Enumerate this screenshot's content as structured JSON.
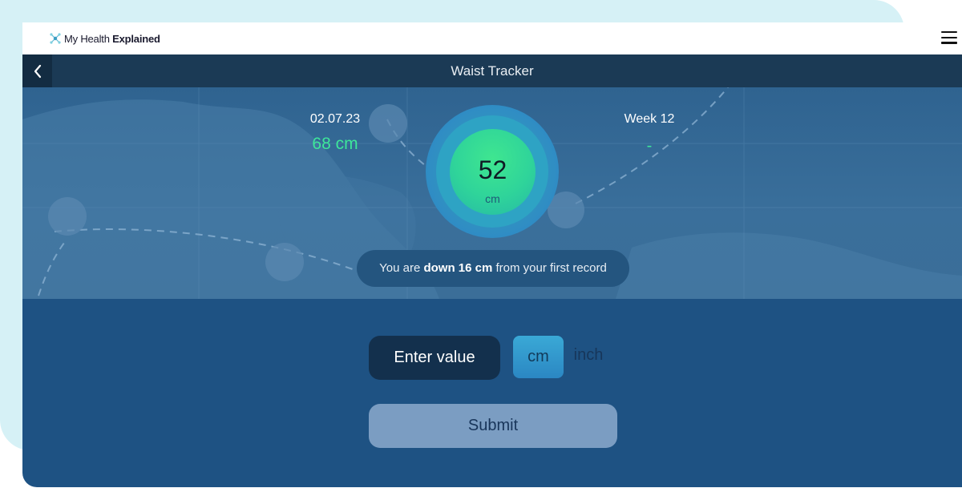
{
  "app": {
    "brand_prefix": "My Health ",
    "brand_bold": "Explained",
    "menu_icon": "hamburger-menu-icon"
  },
  "header": {
    "title": "Waist Tracker",
    "back_icon": "chevron-left-icon"
  },
  "stats": {
    "date": "02.07.23",
    "first_measurement": "68 cm",
    "week_label": "Week 12",
    "week_value": "-"
  },
  "gauge": {
    "value": "52",
    "unit": "cm"
  },
  "summary": {
    "prefix": "You are ",
    "highlight": "down 16 cm",
    "suffix": " from your first record"
  },
  "input": {
    "placeholder": "Enter value",
    "units": [
      "cm",
      "inch"
    ],
    "selected_unit": "cm"
  },
  "submit_label": "Submit",
  "colors": {
    "accent_green": "#3ee69a",
    "panel_blue": "#1e5283",
    "header_navy": "#1b3a55",
    "outer_bg": "#d6f1f6"
  }
}
